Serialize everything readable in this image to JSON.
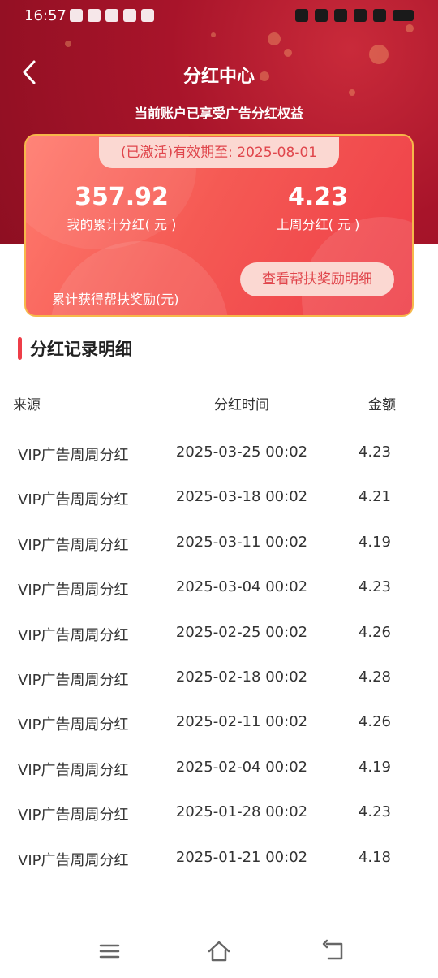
{
  "status_bar": {
    "time": "16:57",
    "app_icons": [
      "tiktok-icon",
      "app-icon",
      "telegram-icon",
      "video-icon",
      "scan-icon"
    ],
    "right_icons": [
      "alarm-icon",
      "vibrate-icon",
      "hd-icon",
      "signal-icon",
      "wifi-icon"
    ]
  },
  "header": {
    "title": "分红中心",
    "subtitle": "当前账户已享受广告分红权益"
  },
  "card": {
    "expiry": "(已激活)有效期至: 2025-08-01",
    "total_value": "357.92",
    "total_label": "我的累计分红( 元 )",
    "last_week_value": "4.23",
    "last_week_label": "上周分红( 元 )",
    "cumulative_reward_label": "累计获得帮扶奖励(元)",
    "detail_button": "查看帮扶奖励明细"
  },
  "section": {
    "title": "分红记录明细"
  },
  "table": {
    "headers": {
      "source": "来源",
      "time": "分红时间",
      "amount": "金额"
    },
    "rows": [
      {
        "source": "VIP广告周周分红",
        "time": "2025-03-25 00:02",
        "amount": "4.23"
      },
      {
        "source": "VIP广告周周分红",
        "time": "2025-03-18 00:02",
        "amount": "4.21"
      },
      {
        "source": "VIP广告周周分红",
        "time": "2025-03-11 00:02",
        "amount": "4.19"
      },
      {
        "source": "VIP广告周周分红",
        "time": "2025-03-04 00:02",
        "amount": "4.23"
      },
      {
        "source": "VIP广告周周分红",
        "time": "2025-02-25 00:02",
        "amount": "4.26"
      },
      {
        "source": "VIP广告周周分红",
        "time": "2025-02-18 00:02",
        "amount": "4.28"
      },
      {
        "source": "VIP广告周周分红",
        "time": "2025-02-11 00:02",
        "amount": "4.26"
      },
      {
        "source": "VIP广告周周分红",
        "time": "2025-02-04 00:02",
        "amount": "4.19"
      },
      {
        "source": "VIP广告周周分红",
        "time": "2025-01-28 00:02",
        "amount": "4.23"
      },
      {
        "source": "VIP广告周周分红",
        "time": "2025-01-21 00:02",
        "amount": "4.18"
      }
    ]
  },
  "colors": {
    "hero_red": "#a8142a",
    "card_red": "#f55a54",
    "card_border": "#f6b84a",
    "pill_bg": "#fbd8d2",
    "accent": "#ee3e48"
  }
}
